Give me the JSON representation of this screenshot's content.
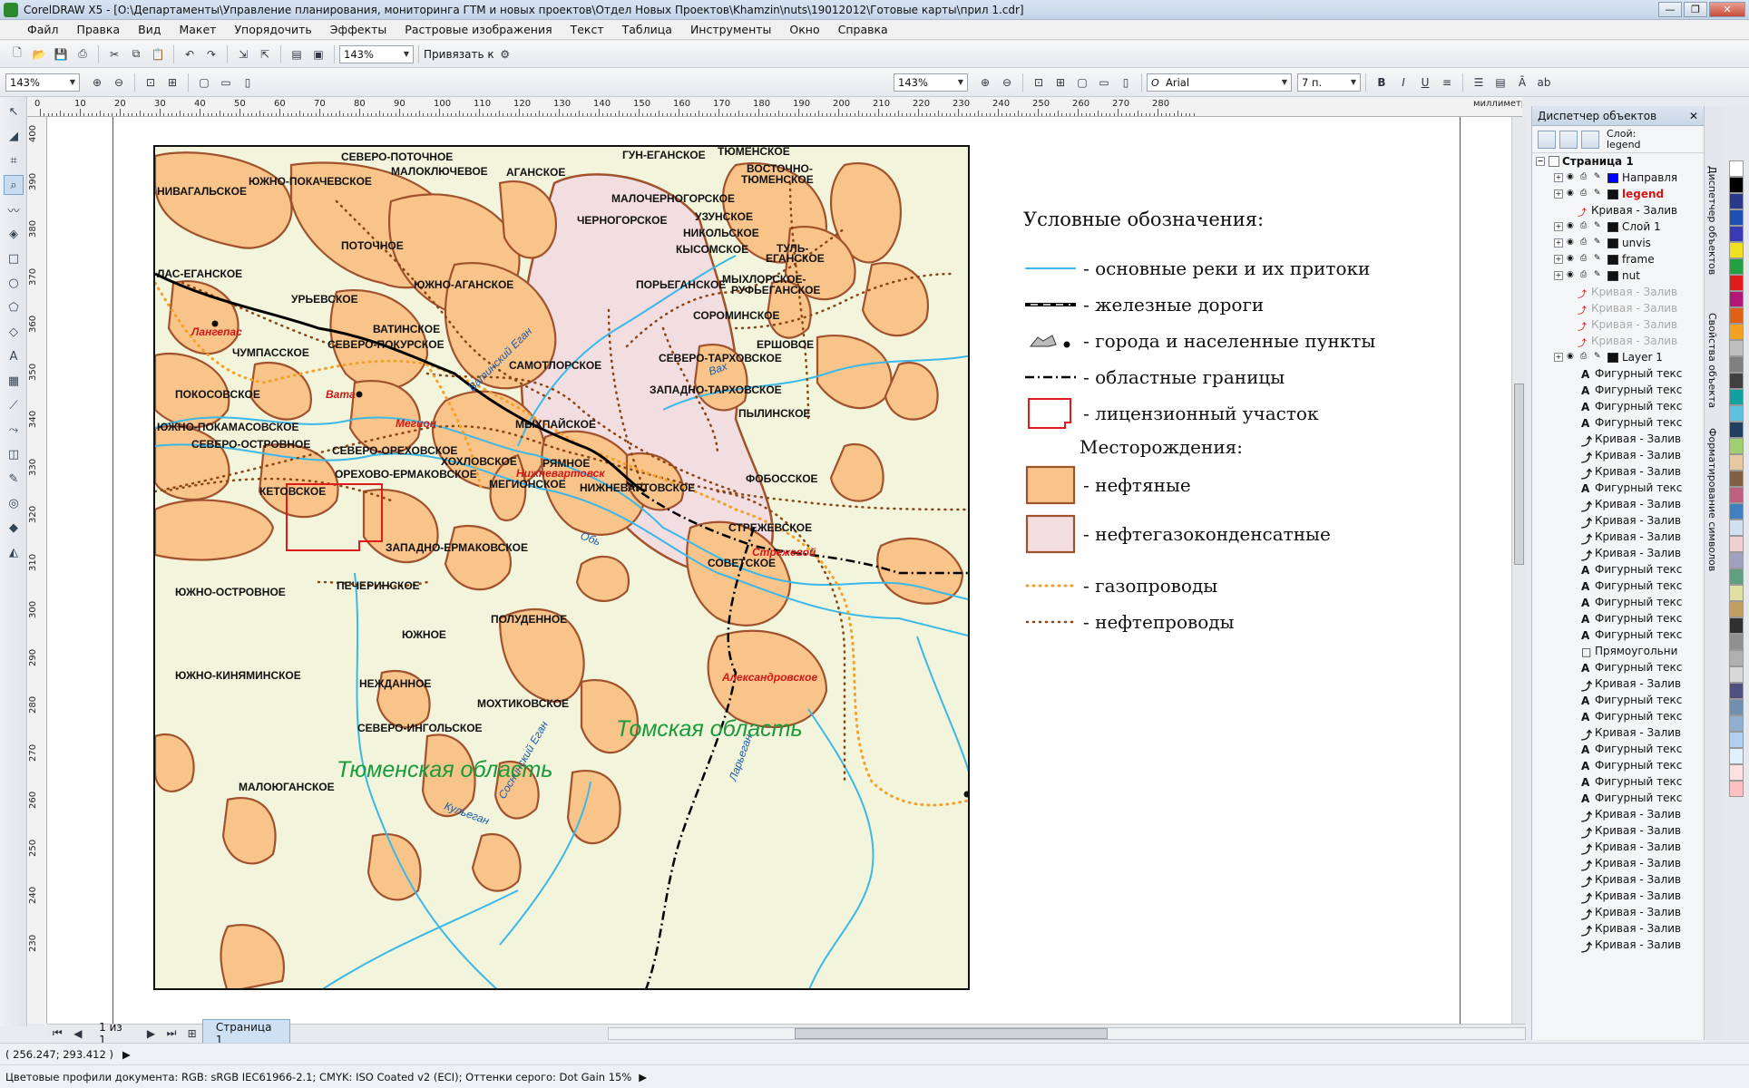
{
  "window": {
    "title": "CorelDRAW X5 - [O:\\Департаменты\\Управление планирования, мониторинга ГТМ и новых проектов\\Отдел Новых Проектов\\Khamzin\\nuts\\19012012\\Готовые карты\\прил 1.cdr]"
  },
  "menu": [
    "Файл",
    "Правка",
    "Вид",
    "Макет",
    "Упорядочить",
    "Эффекты",
    "Растровые изображения",
    "Текст",
    "Таблица",
    "Инструменты",
    "Окно",
    "Справка"
  ],
  "toolbar1": {
    "zoom": "143%",
    "snap_label": "Привязать к"
  },
  "toolbar2": {
    "zoom_left": "143%",
    "zoom_right": "143%",
    "font": "Arial",
    "font_size": "7 п."
  },
  "ruler": {
    "unit": "миллиметры",
    "h_ticks": [
      "0",
      "10",
      "20",
      "30",
      "40",
      "50",
      "60",
      "70",
      "80",
      "90",
      "100",
      "110",
      "120",
      "130",
      "140",
      "150",
      "160",
      "170",
      "180",
      "190",
      "200",
      "210",
      "220",
      "230",
      "240",
      "250",
      "260",
      "270",
      "280"
    ],
    "v_ticks": [
      "400",
      "390",
      "380",
      "370",
      "360",
      "350",
      "340",
      "330",
      "320",
      "310",
      "300",
      "290",
      "280",
      "270",
      "260",
      "250",
      "240",
      "230"
    ],
    "v_unit": "миллиметры"
  },
  "map": {
    "fields": [
      "СЕВЕРО-ПОТОЧНОЕ",
      "МАЛОКЛЮЧЕВОЕ",
      "АГАНСКОЕ",
      "ГУН-ЕГАНСКОЕ",
      "ТЮМЕНСКОЕ",
      "ВОСТОЧНО-",
      "ТЮМЕНСКОЕ",
      "ЮЖНО-ПОКАЧЕВСКОЕ",
      "НИВАГАЛЬСКОЕ",
      "МАЛОЧЕРНОГОРСКОЕ",
      "УЗУНСКОЕ",
      "ЧЕРНОГОРСКОЕ",
      "НИКОЛЬСКОЕ",
      "ПОТОЧНОЕ",
      "КЫСОМСКОЕ",
      "ТУЛЬ-",
      "ЕГАНСКОЕ",
      "ЛАС-ЕГАНСКОЕ",
      "ЮЖНО-АГАНСКОЕ",
      "ПОРЬЕГАНСКОЕ",
      "МЫХЛОРСКОЕ-",
      "РУФЬЕГАНСКОЕ",
      "УРЬЕВСКОЕ",
      "СОРОМИНСКОЕ",
      "ВАТИНСКОЕ",
      "СЕВЕРО-ПОКУРСКОЕ",
      "ЕРШОВОЕ",
      "ЧУМПАССКОЕ",
      "СЕВЕРО-ТАРХОВСКОЕ",
      "САМОТЛОРСКОЕ",
      "ЗАПАДНО-ТАРХОВСКОЕ",
      "ПОКОСОВСКОЕ",
      "ПЫЛИНСКОЕ",
      "ЮЖНО-ПОКАМАСОВСКОЕ",
      "МЫХПАЙСКОЕ",
      "СЕВЕРО-ОСТРОВНОЕ",
      "СЕВЕРО-ОРЕХОВСКОЕ",
      "РЯМНОЕ",
      "ХОХЛОВСКОЕ",
      "ОРЕХОВО-ЕРМАКОВСКОЕ",
      "ФОБОССКОЕ",
      "МЕГИОНСКОЕ",
      "НИЖНЕВАРТОВСКОЕ",
      "КЕТОВСКОЕ",
      "СТРЕЖЕВСКОЕ",
      "ЗАПАДНО-ЕРМАКОВСКОЕ",
      "СОВЕТСКОЕ",
      "ПЕЧЕРИНСКОЕ",
      "ЮЖНО-ОСТРОВНОЕ",
      "ПОЛУДЕННОЕ",
      "ЮЖНОЕ",
      "ЮЖНО-КИНЯМИНСКОЕ",
      "НЕЖДАННОЕ",
      "МОХТИКОВСКОЕ",
      "СЕВЕРО-ИНГОЛЬСКОЕ",
      "МАЛОЮГАНСКОЕ"
    ],
    "cities": [
      "Лангепас",
      "Вата",
      "Мегион",
      "Нижневартовск",
      "Стрежевой",
      "Александровское"
    ],
    "rivers": [
      "Ватинский Еган",
      "Вах",
      "Обь",
      "Соснинский Еган",
      "Ларьеган",
      "Кульеган"
    ],
    "regions": [
      "Тюменская  область",
      "Томская  область"
    ]
  },
  "legend": {
    "title": "Условные  обозначения:",
    "rivers": "- основные реки и их притоки",
    "railways": "- железные дороги",
    "cities": "- города и населенные пункты",
    "borders": "- областные границы",
    "license": "- лицензионный участок",
    "deposits_title": "Месторождения:",
    "oil": "- нефтяные",
    "oilgas": "- нефтегазоконденсатные",
    "gas_pipes": "- газопроводы",
    "oil_pipes": "- нефтепроводы"
  },
  "colors": {
    "oil": "#f8c48a",
    "oilgas": "#f2dde0",
    "border": "#a0522d",
    "gas": "#f2a22a",
    "river": "#3cb8e8",
    "license": "#e01a1a",
    "region": "#1a9a3a"
  },
  "page_nav": {
    "counter": "1 из 1",
    "tab": "Страница 1"
  },
  "docker": {
    "title": "Диспетчер объектов",
    "layer_label": "Слой:",
    "layer_value": "legend",
    "page": "Страница 1",
    "layers": [
      {
        "name": "Направля",
        "color": "#0000ff"
      },
      {
        "name": "legend",
        "color": "#111111"
      },
      {
        "name": "Кривая - Залив",
        "color": ""
      },
      {
        "name": "Слой 1",
        "color": "#111111"
      },
      {
        "name": "unvis",
        "color": "#111111"
      },
      {
        "name": "frame",
        "color": "#111111"
      },
      {
        "name": "nut",
        "color": "#111111"
      },
      {
        "name": "Кривая - Залив",
        "color": ""
      },
      {
        "name": "Кривая - Залив",
        "color": ""
      },
      {
        "name": "Кривая - Залив",
        "color": ""
      },
      {
        "name": "Кривая - Залив",
        "color": ""
      },
      {
        "name": "Layer 1",
        "color": "#111111"
      }
    ],
    "objects": [
      "Фигурный текс",
      "Фигурный текс",
      "Фигурный текс",
      "Фигурный текс",
      "Кривая - Залив",
      "Кривая - Залив",
      "Кривая - Залив",
      "Фигурный текс",
      "Кривая - Залив",
      "Кривая - Залив",
      "Кривая - Залив",
      "Кривая - Залив",
      "Фигурный текс",
      "Фигурный текс",
      "Фигурный текс",
      "Фигурный текс",
      "Фигурный текс",
      "Прямоугольни",
      "Фигурный текс",
      "Кривая - Залив",
      "Фигурный текс",
      "Фигурный текс",
      "Кривая - Залив",
      "Фигурный текс",
      "Фигурный текс",
      "Фигурный текс",
      "Фигурный текс",
      "Кривая - Залив",
      "Кривая - Залив",
      "Кривая - Залив",
      "Кривая - Залив",
      "Кривая - Залив",
      "Кривая - Залив",
      "Кривая - Залив",
      "Кривая - Залив",
      "Кривая - Залив"
    ],
    "side_tabs": [
      "Диспетчер объектов",
      "Свойства объекта",
      "Форматирование символов"
    ]
  },
  "status": {
    "coords": "( 256.247; 293.412 )",
    "profile": "Цветовые профили документа: RGB: sRGB IEC61966-2.1; CMYK: ISO Coated v2 (ECI); Оттенки серого: Dot Gain 15%"
  },
  "palette": [
    "#ffffff",
    "#000000",
    "#2a3a8a",
    "#1e50b4",
    "#3a3ab4",
    "#f0e020",
    "#20a040",
    "#e01a1a",
    "#b01878",
    "#e06018",
    "#f4a020",
    "#c0c0c0",
    "#808080",
    "#404040",
    "#10a0a0",
    "#60c0e0",
    "#204060",
    "#a0d070",
    "#e8c8a0",
    "#806040",
    "#c06080",
    "#4080c0",
    "#d0e0f0",
    "#f0d0d0",
    "#a0a0c0",
    "#60a080",
    "#e0e0a0",
    "#c0a060",
    "#303030",
    "#909090",
    "#b0b0b0",
    "#d8d8d8",
    "#505080",
    "#7090b0",
    "#90b0d0",
    "#b0d0f0",
    "#e0f0ff",
    "#ffe0e0",
    "#ffc0c0"
  ]
}
